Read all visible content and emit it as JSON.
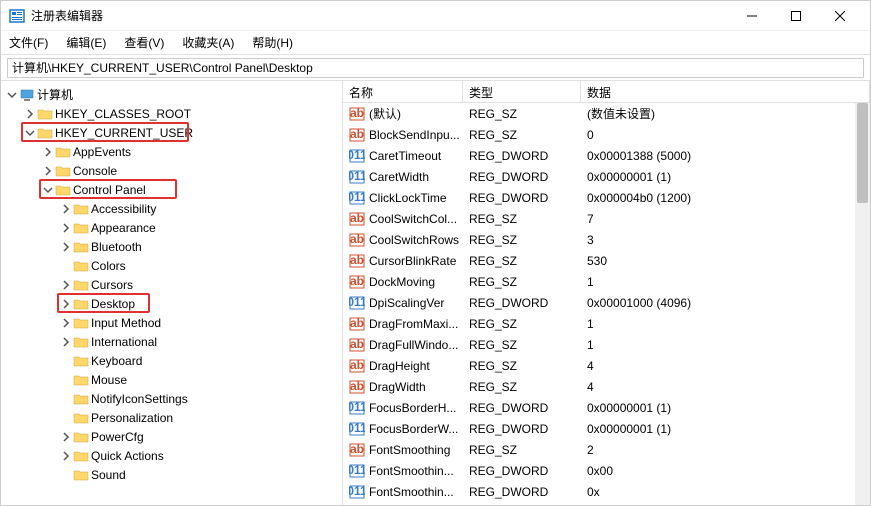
{
  "window": {
    "title": "注册表编辑器"
  },
  "menu": {
    "file": "文件(F)",
    "edit": "编辑(E)",
    "view": "查看(V)",
    "favorites": "收藏夹(A)",
    "help": "帮助(H)"
  },
  "path": "计算机\\HKEY_CURRENT_USER\\Control Panel\\Desktop",
  "tree": {
    "root": "计算机",
    "hives": [
      {
        "label": "HKEY_CLASSES_ROOT",
        "expanded": false,
        "indent": 1
      },
      {
        "label": "HKEY_CURRENT_USER",
        "expanded": true,
        "indent": 1,
        "highlight": true,
        "children": [
          {
            "label": "AppEvents",
            "expanded": false,
            "indent": 2
          },
          {
            "label": "Console",
            "expanded": false,
            "indent": 2
          },
          {
            "label": "Control Panel",
            "expanded": true,
            "indent": 2,
            "highlight": true,
            "children": [
              {
                "label": "Accessibility",
                "expanded": false,
                "indent": 3
              },
              {
                "label": "Appearance",
                "expanded": false,
                "indent": 3
              },
              {
                "label": "Bluetooth",
                "expanded": false,
                "indent": 3
              },
              {
                "label": "Colors",
                "expanded": false,
                "indent": 3,
                "leaf": true
              },
              {
                "label": "Cursors",
                "expanded": false,
                "indent": 3
              },
              {
                "label": "Desktop",
                "expanded": false,
                "indent": 3,
                "highlight": true
              },
              {
                "label": "Input Method",
                "expanded": false,
                "indent": 3
              },
              {
                "label": "International",
                "expanded": false,
                "indent": 3
              },
              {
                "label": "Keyboard",
                "expanded": false,
                "indent": 3,
                "leaf": true
              },
              {
                "label": "Mouse",
                "expanded": false,
                "indent": 3,
                "leaf": true
              },
              {
                "label": "NotifyIconSettings",
                "expanded": false,
                "indent": 3,
                "leaf": true
              },
              {
                "label": "Personalization",
                "expanded": false,
                "indent": 3,
                "leaf": true
              },
              {
                "label": "PowerCfg",
                "expanded": false,
                "indent": 3
              },
              {
                "label": "Quick Actions",
                "expanded": false,
                "indent": 3
              },
              {
                "label": "Sound",
                "expanded": false,
                "indent": 3,
                "leaf": true
              }
            ]
          }
        ]
      }
    ]
  },
  "columns": {
    "name": "名称",
    "type": "类型",
    "data": "数据"
  },
  "values": [
    {
      "name": "(默认)",
      "type": "REG_SZ",
      "data": "(数值未设置)",
      "icon": "sz"
    },
    {
      "name": "BlockSendInpu...",
      "type": "REG_SZ",
      "data": "0",
      "icon": "sz"
    },
    {
      "name": "CaretTimeout",
      "type": "REG_DWORD",
      "data": "0x00001388 (5000)",
      "icon": "dw"
    },
    {
      "name": "CaretWidth",
      "type": "REG_DWORD",
      "data": "0x00000001 (1)",
      "icon": "dw"
    },
    {
      "name": "ClickLockTime",
      "type": "REG_DWORD",
      "data": "0x000004b0 (1200)",
      "icon": "dw"
    },
    {
      "name": "CoolSwitchCol...",
      "type": "REG_SZ",
      "data": "7",
      "icon": "sz"
    },
    {
      "name": "CoolSwitchRows",
      "type": "REG_SZ",
      "data": "3",
      "icon": "sz"
    },
    {
      "name": "CursorBlinkRate",
      "type": "REG_SZ",
      "data": "530",
      "icon": "sz"
    },
    {
      "name": "DockMoving",
      "type": "REG_SZ",
      "data": "1",
      "icon": "sz"
    },
    {
      "name": "DpiScalingVer",
      "type": "REG_DWORD",
      "data": "0x00001000 (4096)",
      "icon": "dw"
    },
    {
      "name": "DragFromMaxi...",
      "type": "REG_SZ",
      "data": "1",
      "icon": "sz"
    },
    {
      "name": "DragFullWindo...",
      "type": "REG_SZ",
      "data": "1",
      "icon": "sz"
    },
    {
      "name": "DragHeight",
      "type": "REG_SZ",
      "data": "4",
      "icon": "sz"
    },
    {
      "name": "DragWidth",
      "type": "REG_SZ",
      "data": "4",
      "icon": "sz"
    },
    {
      "name": "FocusBorderH...",
      "type": "REG_DWORD",
      "data": "0x00000001 (1)",
      "icon": "dw"
    },
    {
      "name": "FocusBorderW...",
      "type": "REG_DWORD",
      "data": "0x00000001 (1)",
      "icon": "dw"
    },
    {
      "name": "FontSmoothing",
      "type": "REG_SZ",
      "data": "2",
      "icon": "sz"
    },
    {
      "name": "FontSmoothin...",
      "type": "REG_DWORD",
      "data": "0x00",
      "icon": "dw"
    },
    {
      "name": "FontSmoothin...",
      "type": "REG_DWORD",
      "data": "0x",
      "icon": "dw"
    }
  ]
}
